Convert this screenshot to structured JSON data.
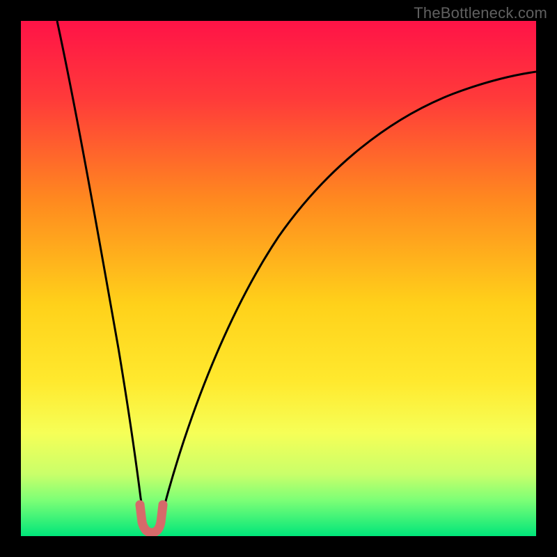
{
  "watermark": {
    "text": "TheBottleneck.com"
  },
  "chart_data": {
    "type": "line",
    "title": "",
    "xlabel": "",
    "ylabel": "",
    "xlim": [
      0,
      100
    ],
    "ylim": [
      0,
      100
    ],
    "grid": false,
    "legend": false,
    "background_gradient_bands": [
      {
        "position_pct": 0,
        "color": "#ff1347"
      },
      {
        "position_pct": 15,
        "color": "#ff3a3a"
      },
      {
        "position_pct": 35,
        "color": "#ff8a1f"
      },
      {
        "position_pct": 55,
        "color": "#ffd11a"
      },
      {
        "position_pct": 70,
        "color": "#ffe92e"
      },
      {
        "position_pct": 80,
        "color": "#f6ff57"
      },
      {
        "position_pct": 88,
        "color": "#c9ff6a"
      },
      {
        "position_pct": 93,
        "color": "#7dff76"
      },
      {
        "position_pct": 100,
        "color": "#00e67a"
      }
    ],
    "series": [
      {
        "name": "bottleneck-left-branch",
        "stroke": "#000000",
        "x": [
          7,
          10,
          13,
          16,
          19,
          21,
          22.5,
          23.5
        ],
        "y": [
          100,
          81,
          63,
          45,
          28,
          14,
          6,
          2
        ]
      },
      {
        "name": "bottleneck-right-branch",
        "stroke": "#000000",
        "x": [
          26,
          27.5,
          30,
          34,
          40,
          48,
          58,
          70,
          84,
          100
        ],
        "y": [
          2,
          6,
          16,
          31,
          48,
          62,
          73,
          81,
          86,
          89
        ]
      },
      {
        "name": "optimal-marker",
        "stroke": "#d66a6a",
        "marker_only": true,
        "x_range": [
          22.5,
          27
        ],
        "y_range": [
          0,
          3
        ],
        "shape": "U"
      }
    ],
    "annotations": []
  }
}
